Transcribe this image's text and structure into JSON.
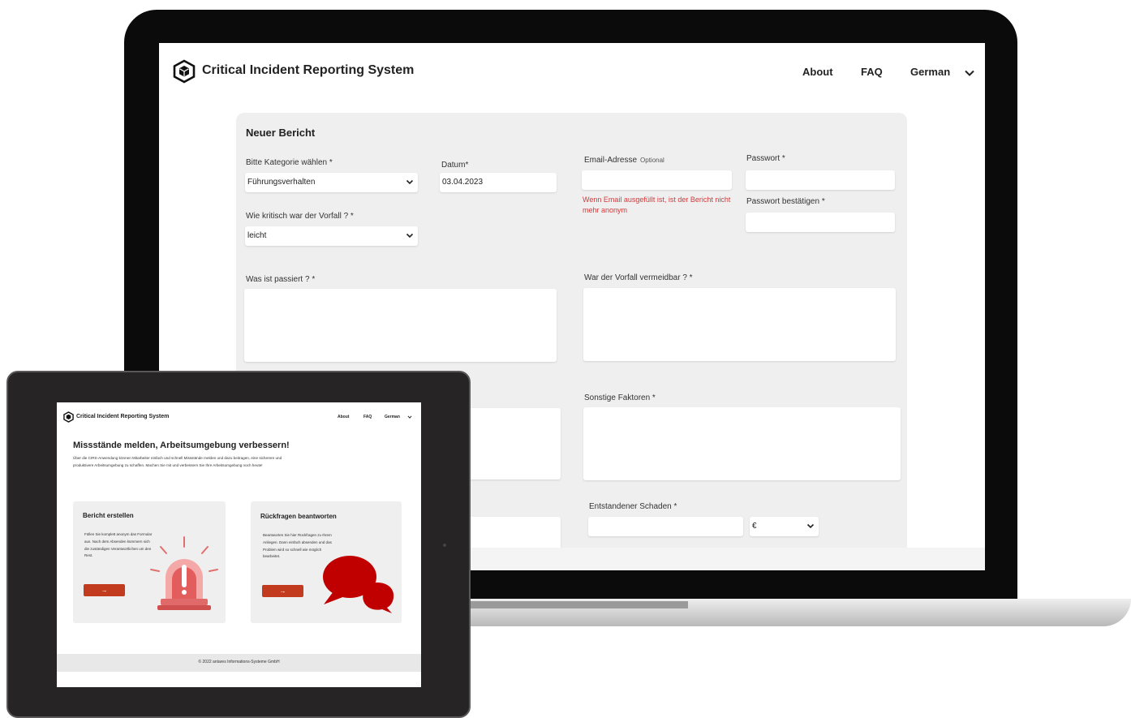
{
  "laptop": {
    "app_title": "Critical Incident Reporting System",
    "nav": {
      "about": "About",
      "faq": "FAQ",
      "language": "German"
    },
    "form": {
      "heading": "Neuer Bericht",
      "category_label": "Bitte Kategorie wählen *",
      "category_value": "Führungsverhalten",
      "date_label": "Datum*",
      "date_value": "03.04.2023",
      "email_label": "Email-Adresse",
      "email_optional": "Optional",
      "email_warning": "Wenn Email ausgefüllt ist, ist der Bericht nicht mehr anonym",
      "password_label": "Passwort *",
      "password_confirm_label": "Passwort bestätigen *",
      "criticality_label": "Wie kritisch war der Vorfall ? *",
      "criticality_value": "leicht",
      "what_happened_label": "Was ist passiert ? *",
      "avoidable_label": "War der Vorfall vermeidbar ? *",
      "other_factors_label": "Sonstige Faktoren *",
      "damage_label": "Entstandener Schaden *",
      "currency_value": "€"
    }
  },
  "tablet": {
    "app_title": "Critical Incident Reporting System",
    "nav": {
      "about": "About",
      "faq": "FAQ",
      "language": "German"
    },
    "hero_heading": "Missstände melden, Arbeitsumgebung verbessern!",
    "hero_text": "Über die CIRS-Anwendung können Mitarbeiter einfach und schnell Missstände melden und dazu beitragen, eine sicherere und produktivere Arbeitsumgebung zu schaffen. Machen Sie mit und verbessern Sie Ihre Arbeitsumgebung noch heute!",
    "card_report": {
      "title": "Bericht erstellen",
      "text": "Füllen Sie komplett anonym das Formular aus. Nach dem Absenden kümmern sich die zuständigen Verantwortlichen um den Rest.",
      "button": "→"
    },
    "card_reply": {
      "title": "Rückfragen beantworten",
      "text": "Beantworten Sie hier Rückfragen zu Ihrem Anliegen. Dann einfach absenden und das Problem wird so schnell wie möglich bearbeitet.",
      "button": "→"
    },
    "footer": "© 2022 antares Informations-Systeme GmbH"
  },
  "colors": {
    "accent": "#c23b1e",
    "warning": "#d23a3a",
    "siren": "#e05a5a",
    "bubble": "#c00000"
  }
}
